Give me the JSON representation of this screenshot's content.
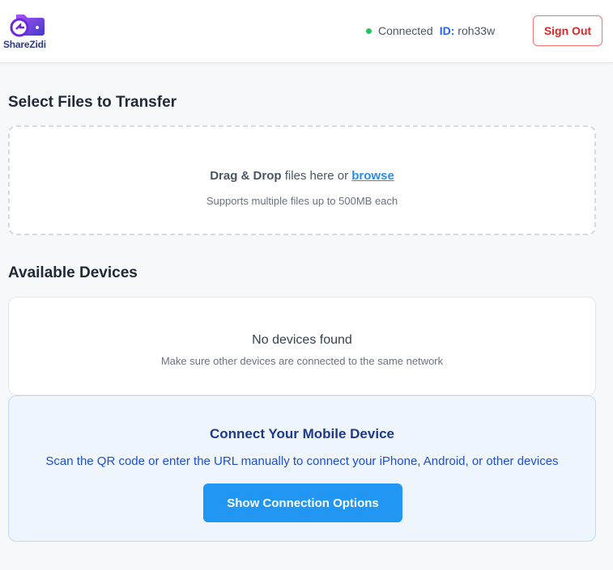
{
  "header": {
    "logo_text": "ShareZidi",
    "status_label": "Connected",
    "id_label": "ID:",
    "id_value": "roh33w",
    "signout_label": "Sign Out"
  },
  "upload": {
    "section_title": "Select Files to Transfer",
    "drop_bold": "Drag & Drop",
    "drop_text": " files here or ",
    "browse_label": "browse",
    "drop_sub": "Supports multiple files up to 500MB each"
  },
  "devices": {
    "section_title": "Available Devices",
    "empty_title": "No devices found",
    "empty_sub": "Make sure other devices are connected to the same network"
  },
  "mobile": {
    "title": "Connect Your Mobile Device",
    "subtitle": "Scan the QR code or enter the URL manually to connect your iPhone, Android, or other devices",
    "button_label": "Show Connection Options"
  },
  "colors": {
    "accent": "#2196f3",
    "connected": "#22c55e",
    "signout": "#dc2626"
  }
}
